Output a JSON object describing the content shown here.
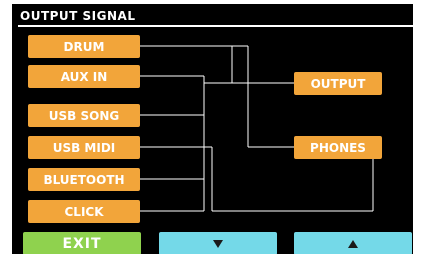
{
  "header": {
    "title": "OUTPUT SIGNAL"
  },
  "sources": [
    {
      "label": "DRUM"
    },
    {
      "label": "AUX IN"
    },
    {
      "label": "USB SONG"
    },
    {
      "label": "USB MIDI"
    },
    {
      "label": "BLUETOOTH"
    },
    {
      "label": "CLICK"
    }
  ],
  "destinations": [
    {
      "label": "OUTPUT"
    },
    {
      "label": "PHONES"
    }
  ],
  "routing": {
    "OUTPUT": [
      "DRUM",
      "AUX IN",
      "USB SONG",
      "BLUETOOTH",
      "CLICK"
    ],
    "PHONES": [
      "DRUM",
      "USB MIDI"
    ]
  },
  "footer": {
    "exit_label": "EXIT",
    "down_icon": "triangle-down-icon",
    "up_icon": "triangle-up-icon"
  },
  "colors": {
    "background": "#000000",
    "source_button": "#f2a53a",
    "destination_button": "#f2a53a",
    "exit_button": "#8fd24e",
    "nav_button": "#74d9e8",
    "line": "#ffffff"
  }
}
